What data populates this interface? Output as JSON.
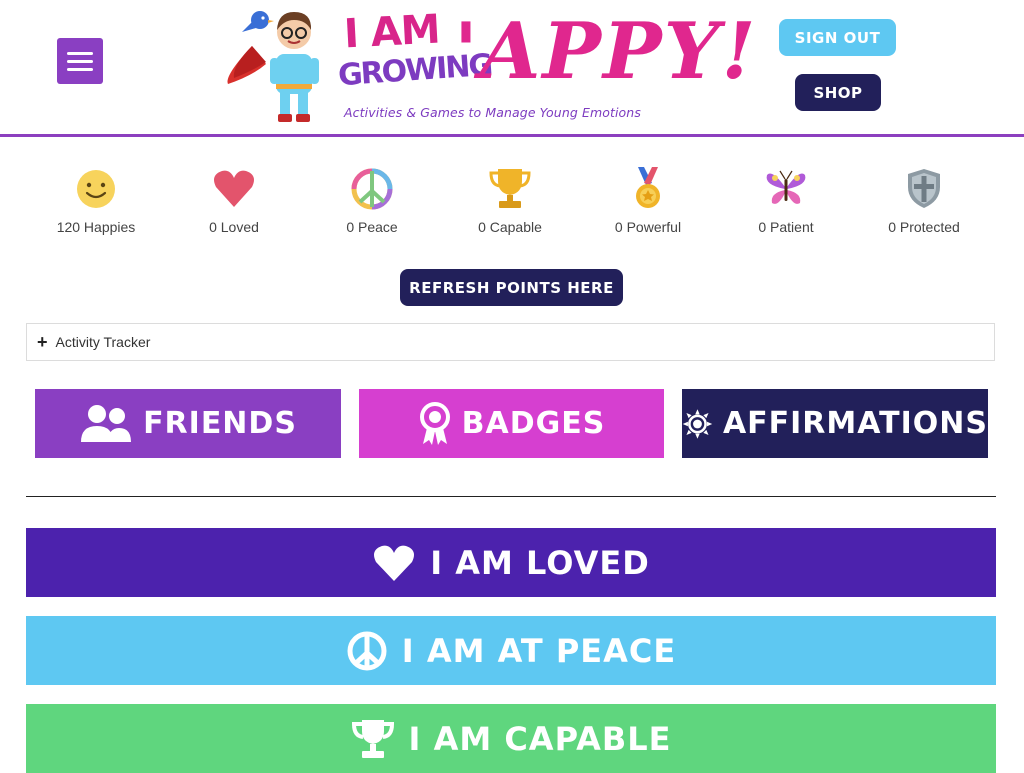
{
  "header": {
    "logo_line1": "I AM",
    "logo_line2": "GROWING",
    "logo_word": "'APPY!",
    "logo_tagline": "Activities & Games to Manage Young Emotions",
    "sign_out_label": "SIGN OUT",
    "shop_label": "SHOP"
  },
  "stats": [
    {
      "label": "120 Happies",
      "icon": "smiley-face-icon"
    },
    {
      "label": "0 Loved",
      "icon": "heart-icon"
    },
    {
      "label": "0 Peace",
      "icon": "peace-sign-icon"
    },
    {
      "label": "0 Capable",
      "icon": "trophy-icon"
    },
    {
      "label": "0 Powerful",
      "icon": "medal-icon"
    },
    {
      "label": "0 Patient",
      "icon": "butterfly-icon"
    },
    {
      "label": "0 Protected",
      "icon": "shield-icon"
    }
  ],
  "refresh_label": "REFRESH POINTS HERE",
  "tracker_label": "Activity Tracker",
  "categories": [
    {
      "label": "FRIENDS",
      "icon": "friends-icon",
      "color": "#8a3fc2"
    },
    {
      "label": "BADGES",
      "icon": "badge-ribbon-icon",
      "color": "#d63fd0"
    },
    {
      "label": "AFFIRMATIONS",
      "icon": "sun-icon",
      "color": "#22205a"
    }
  ],
  "sections": [
    {
      "label": "I AM LOVED",
      "icon": "heart-icon",
      "color": "#4c22ad"
    },
    {
      "label": "I AM AT PEACE",
      "icon": "peace-sign-icon",
      "color": "#5ec8f2"
    },
    {
      "label": "I AM CAPABLE",
      "icon": "trophy-icon",
      "color": "#5fd67e"
    }
  ],
  "colors": {
    "header_border": "#8c3fbf",
    "menu": "#8a3fc2",
    "dark_button": "#22205a",
    "light_button": "#5ec8f2"
  }
}
